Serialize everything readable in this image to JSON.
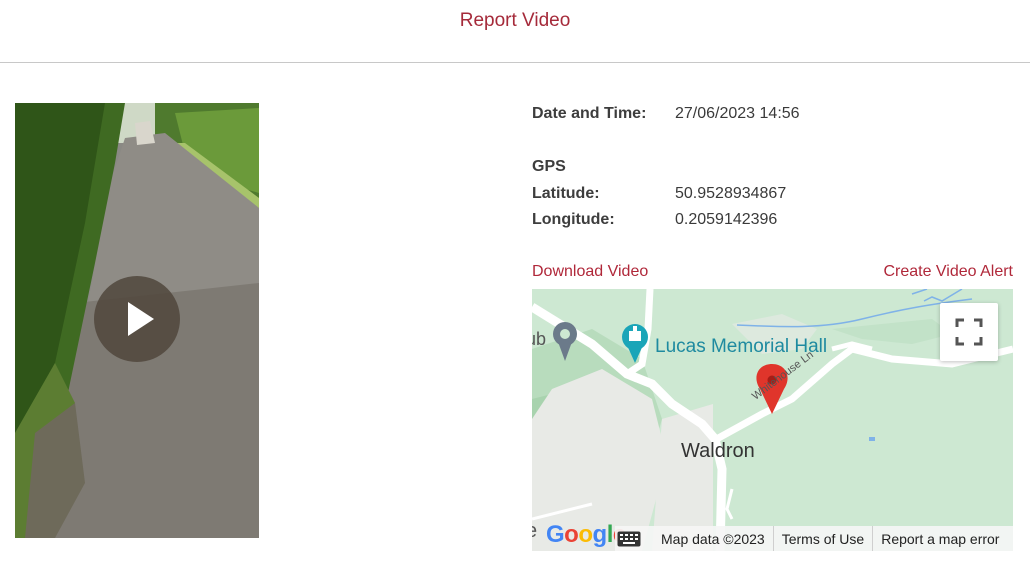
{
  "header": {
    "title": "Report Video"
  },
  "details": {
    "datetime_label": "Date and Time:",
    "datetime_value": "27/06/2023 14:56",
    "gps_heading": "GPS",
    "latitude_label": "Latitude:",
    "latitude_value": "50.9528934867",
    "longitude_label": "Longitude:",
    "longitude_value": "0.2059142396"
  },
  "actions": {
    "download_label": "Download Video",
    "alert_label": "Create Video Alert"
  },
  "map": {
    "place_label": "Waldron",
    "hall_label": "Lucas Memorial Hall",
    "street_label": "Whitehouse Ln",
    "partial_label": "ub",
    "footer": {
      "data_label": "Map data ©2023",
      "terms_label": "Terms of Use",
      "report_label": "Report a map error"
    },
    "logo_text": "Google"
  },
  "colors": {
    "accent": "#b0283a",
    "pin": "#e0352b",
    "map_bg": "#cde8d2"
  }
}
